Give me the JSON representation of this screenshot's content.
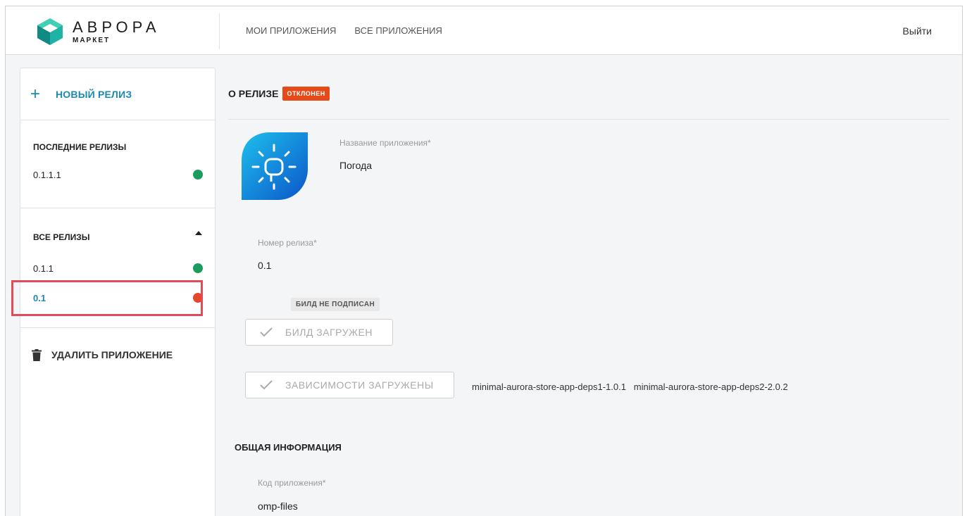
{
  "header": {
    "logo_title": "АВРОРА",
    "logo_subtitle": "МАРКЕТ",
    "nav": [
      "МОИ ПРИЛОЖЕНИЯ",
      "ВСЕ ПРИЛОЖЕНИЯ"
    ],
    "logout": "Выйти"
  },
  "sidebar": {
    "new_release": "НОВЫЙ РЕЛИЗ",
    "latest_heading": "ПОСЛЕДНИЕ РЕЛИЗЫ",
    "latest": [
      {
        "label": "0.1.1.1",
        "status": "green"
      }
    ],
    "all_heading": "ВСЕ РЕЛИЗЫ",
    "all": [
      {
        "label": "0.1.1",
        "status": "green"
      },
      {
        "label": "0.1",
        "status": "red"
      }
    ],
    "delete_app": "УДАЛИТЬ ПРИЛОЖЕНИЕ"
  },
  "main": {
    "title": "О РЕЛИЗЕ",
    "status_badge": "ОТКЛОНЕН",
    "app_name_label": "Название приложения*",
    "app_name": "Погода",
    "release_number_label": "Номер релиза*",
    "release_number": "0.1",
    "build_tag": "БИЛД НЕ ПОДПИСАН",
    "build_button": "БИЛД ЗАГРУЖЕН",
    "deps_button": "ЗАВИСИМОСТИ ЗАГРУЖЕНЫ",
    "deps": "minimal-aurora-store-app-deps1-1.0.1   minimal-aurora-store-app-deps2-2.0.2",
    "general_info_title": "ОБЩАЯ ИНФОРМАЦИЯ",
    "app_code_label": "Код приложения*",
    "app_code": "omp-files"
  },
  "colors": {
    "accent": "#1a8ab5",
    "status_ok": "#1d9b5e",
    "status_error": "#e4472b",
    "badge_rejected": "#e64a19",
    "highlight": "#e24c59"
  },
  "icons": [
    "aurora-logo-icon",
    "plus-icon",
    "caret-up-icon",
    "trash-icon",
    "check-icon",
    "weather-sun-icon"
  ]
}
